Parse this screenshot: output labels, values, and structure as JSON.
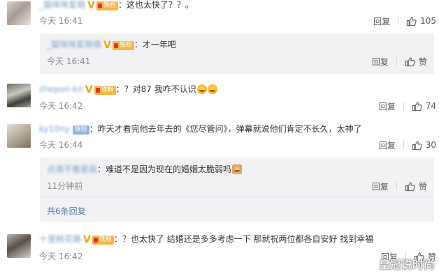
{
  "comments": [
    {
      "user": "_猫咪咪爱萌",
      "badge": "铁粉",
      "text": "这也太快了？？。",
      "time": "今天 16:41",
      "reply_label": "回复",
      "likes": "105",
      "replies": [
        {
          "user": "_猫咪咪爱萌萌",
          "badge": "铁粉",
          "text": "才一年吧",
          "time": "今天 16:41",
          "reply_label": "回复",
          "likes": "赞"
        }
      ]
    },
    {
      "user": "zhepon-kn",
      "badge": "铁粉",
      "text": "？对87 我咋不认识",
      "time": "今天 16:42",
      "reply_label": "回复",
      "likes": "74"
    },
    {
      "user": "ky10ny",
      "badge": "铁粉",
      "text": "昨天才看完他去年去的《您尽管问》，弹幕就说他们肯定不长久，太神了",
      "time": "今天 16:44",
      "reply_label": "回复",
      "likes": "30",
      "replies": [
        {
          "user": "点滴不看星辰",
          "text": "难道不是因为现在的婚姻太脆弱吗",
          "time": "11分钟前",
          "reply_label": "回复",
          "likes": "赞"
        }
      ],
      "more_replies": "共6条回复"
    },
    {
      "user": "十里桃花路",
      "badge": "铁粉",
      "text": "？也太快了 结婚还是多多考虑一下 那就祝两位都各自安好 找到幸福",
      "time": "今天 16:42",
      "reply_label": "回复",
      "likes": "赞"
    }
  ],
  "watermark": "皇冠说时尚"
}
